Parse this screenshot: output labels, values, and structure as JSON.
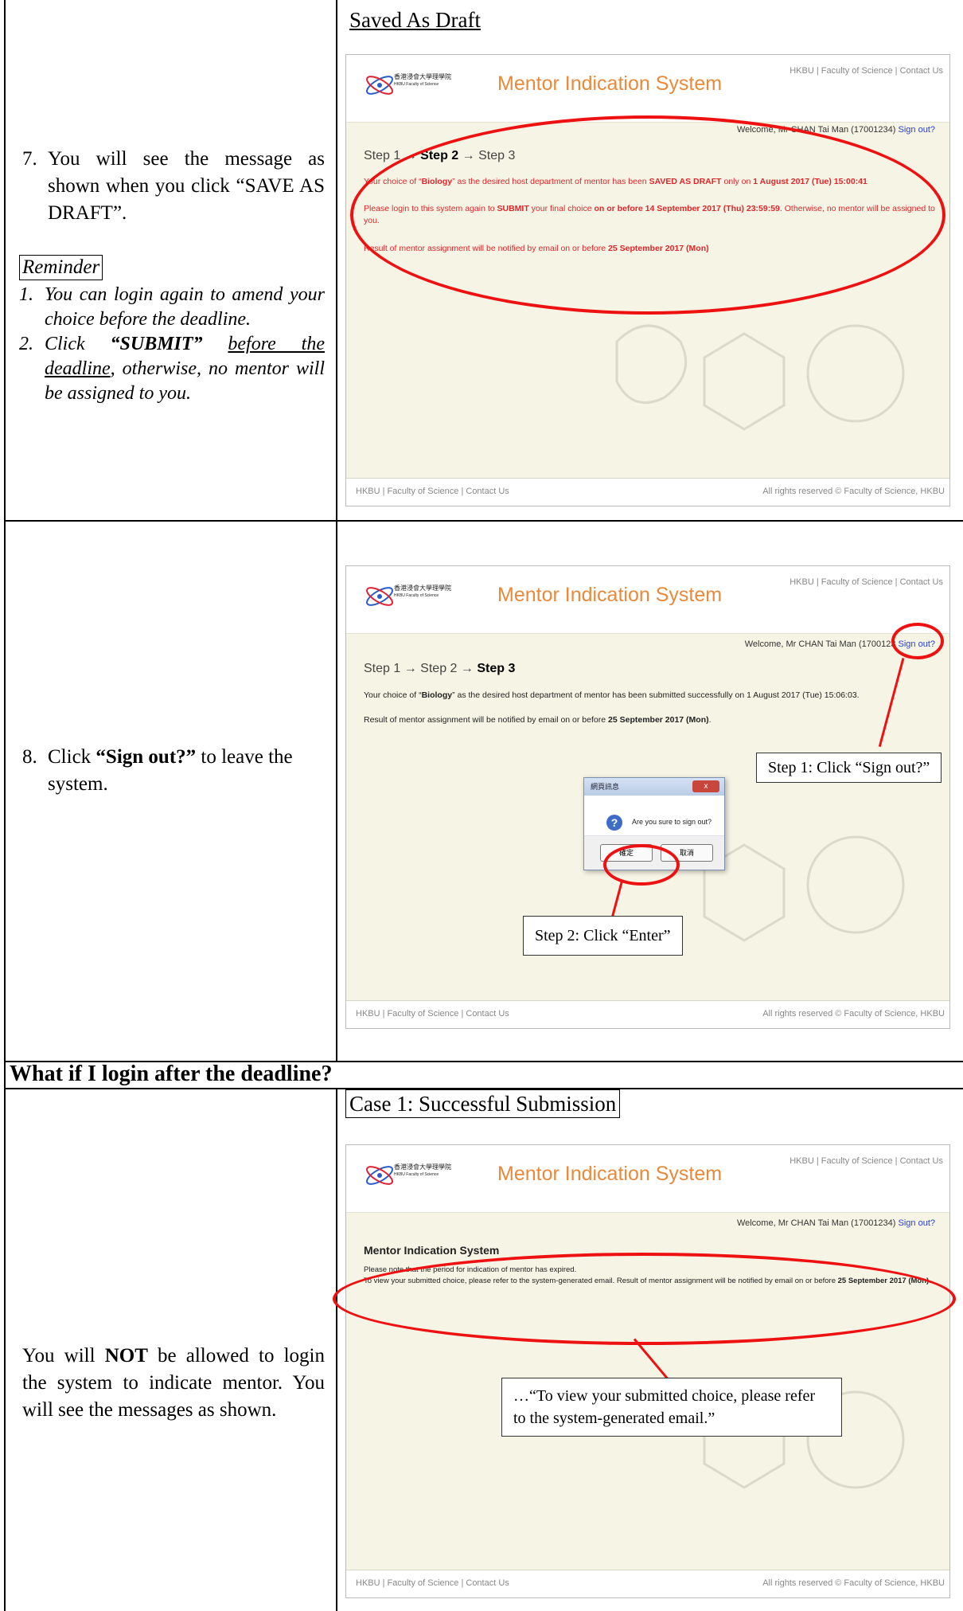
{
  "row1": {
    "instruction_num": "7.",
    "instruction": "You will see the message as shown when you click “SAVE AS DRAFT”.",
    "reminder_title": "Reminder",
    "reminders": [
      {
        "n": "1.",
        "text": "You can login again to amend your choice before the deadline."
      },
      {
        "n": "2.",
        "pre": "Click ",
        "bold": "“SUBMIT”",
        "mid": " ",
        "under": "before the deadline",
        "post": ", otherwise, no mentor will be assigned to you."
      }
    ],
    "caption": "Saved As Draft",
    "screen": {
      "welcome": "Welcome, Mr CHAN Tai Man (17001234)",
      "signout": "Sign out?",
      "steps": {
        "s1": "Step 1",
        "arrow": "→",
        "s2": "Step 2",
        "s3": "Step 3"
      },
      "msg1_a": "Your choice of “",
      "msg1_b": "Biology",
      "msg1_c": "” as the desired host department of mentor has been ",
      "msg1_d": "SAVED AS DRAFT",
      "msg1_e": " only on ",
      "msg1_f": "1 August 2017 (Tue) 15:00:41",
      "msg2_a": "Please login to this system again to ",
      "msg2_b": "SUBMIT",
      "msg2_c": " your final choice ",
      "msg2_d": "on or before 14 September 2017 (Thu) 23:59:59",
      "msg2_e": ". Otherwise, no mentor will be assigned to you.",
      "msg3_a": "Result of mentor assignment will be notified by email on or before ",
      "msg3_b": "25 September 2017 (Mon)"
    }
  },
  "row2": {
    "instruction_num": "8.",
    "instruction_pre": "Click ",
    "instruction_bold": "“Sign out?”",
    "instruction_post": " to leave the system.",
    "screen": {
      "welcome": "Welcome, Mr CHAN Tai Man (1700123",
      "signout": "Sign out?",
      "steps": {
        "s1": "Step 1",
        "arrow": "→",
        "s2": "Step 2",
        "s3": "Step 3"
      },
      "msg1_a": "Your choice of “",
      "msg1_b": "Biology",
      "msg1_c": "” as the desired host department of mentor has been submitted successfully on 1 August 2017 (Tue) 15:06:03.",
      "msg2_a": "Result of mentor assignment will be notified by email on or before ",
      "msg2_b": "25 September 2017 (Mon)",
      "msg2_c": ".",
      "dialog_title": "網頁訊息",
      "dialog_close": "x",
      "dialog_msg": "Are you sure to sign out?",
      "dialog_ok": "確定",
      "dialog_cancel": "取消"
    },
    "callout1": "Step 1: Click “Sign out?”",
    "callout2": "Step 2: Click “Enter”"
  },
  "row3": {
    "heading": "What if I login after the deadline?",
    "caption": "Case 1: Successful Submission",
    "instruction_pre": "You will ",
    "instruction_bold": "NOT",
    "instruction_post": " be allowed to login the system to indicate mentor. You will see the messages as shown.",
    "screen": {
      "welcome": "Welcome, Mr CHAN Tai Man (17001234)",
      "signout": "Sign out?",
      "page_heading": "Mentor Indication System",
      "msg1": "Please note that the period for indication of mentor has expired.",
      "msg2_a": "To view your submitted choice, please refer to the system-generated email. Result of mentor assignment will be notified by email on or before ",
      "msg2_b": "25 September 2017 (Mon)",
      "msg2_c": "."
    },
    "callout": "…“To view your submitted choice, please refer to the system-generated email.”"
  },
  "common": {
    "logo_cn": "香港浸會大學理學院",
    "logo_en": "HKBU Faculty of Science",
    "system_title": "Mentor Indication System",
    "top_links": "HKBU  |  Faculty of Science  |  Contact Us",
    "footer_left": "HKBU  |  Faculty of Science  |  Contact Us",
    "footer_right": "All rights reserved © Faculty of Science, HKBU",
    "annotation_color": "#e11111",
    "title_color": "#e8893b",
    "link_color": "#2a3ed0"
  }
}
